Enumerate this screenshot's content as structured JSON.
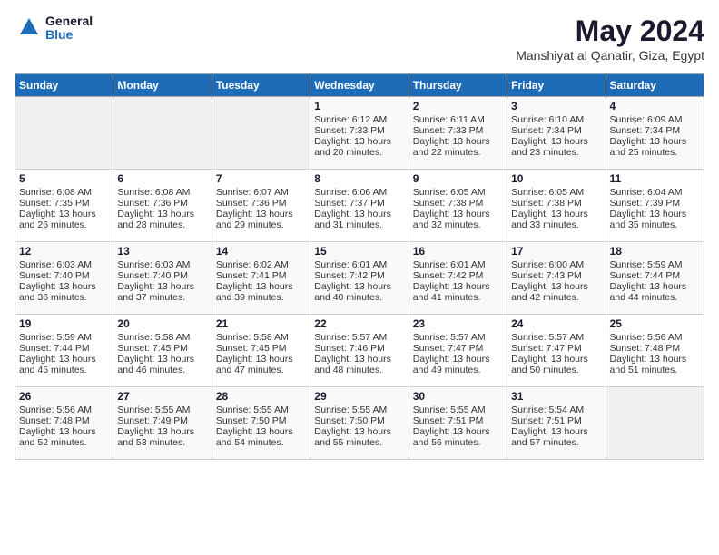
{
  "header": {
    "logo_general": "General",
    "logo_blue": "Blue",
    "month_year": "May 2024",
    "location": "Manshiyat al Qanatir, Giza, Egypt"
  },
  "calendar": {
    "days_of_week": [
      "Sunday",
      "Monday",
      "Tuesday",
      "Wednesday",
      "Thursday",
      "Friday",
      "Saturday"
    ],
    "weeks": [
      [
        {
          "day": "",
          "sunrise": "",
          "sunset": "",
          "daylight": ""
        },
        {
          "day": "",
          "sunrise": "",
          "sunset": "",
          "daylight": ""
        },
        {
          "day": "",
          "sunrise": "",
          "sunset": "",
          "daylight": ""
        },
        {
          "day": "1",
          "sunrise": "Sunrise: 6:12 AM",
          "sunset": "Sunset: 7:33 PM",
          "daylight": "Daylight: 13 hours and 20 minutes."
        },
        {
          "day": "2",
          "sunrise": "Sunrise: 6:11 AM",
          "sunset": "Sunset: 7:33 PM",
          "daylight": "Daylight: 13 hours and 22 minutes."
        },
        {
          "day": "3",
          "sunrise": "Sunrise: 6:10 AM",
          "sunset": "Sunset: 7:34 PM",
          "daylight": "Daylight: 13 hours and 23 minutes."
        },
        {
          "day": "4",
          "sunrise": "Sunrise: 6:09 AM",
          "sunset": "Sunset: 7:34 PM",
          "daylight": "Daylight: 13 hours and 25 minutes."
        }
      ],
      [
        {
          "day": "5",
          "sunrise": "Sunrise: 6:08 AM",
          "sunset": "Sunset: 7:35 PM",
          "daylight": "Daylight: 13 hours and 26 minutes."
        },
        {
          "day": "6",
          "sunrise": "Sunrise: 6:08 AM",
          "sunset": "Sunset: 7:36 PM",
          "daylight": "Daylight: 13 hours and 28 minutes."
        },
        {
          "day": "7",
          "sunrise": "Sunrise: 6:07 AM",
          "sunset": "Sunset: 7:36 PM",
          "daylight": "Daylight: 13 hours and 29 minutes."
        },
        {
          "day": "8",
          "sunrise": "Sunrise: 6:06 AM",
          "sunset": "Sunset: 7:37 PM",
          "daylight": "Daylight: 13 hours and 31 minutes."
        },
        {
          "day": "9",
          "sunrise": "Sunrise: 6:05 AM",
          "sunset": "Sunset: 7:38 PM",
          "daylight": "Daylight: 13 hours and 32 minutes."
        },
        {
          "day": "10",
          "sunrise": "Sunrise: 6:05 AM",
          "sunset": "Sunset: 7:38 PM",
          "daylight": "Daylight: 13 hours and 33 minutes."
        },
        {
          "day": "11",
          "sunrise": "Sunrise: 6:04 AM",
          "sunset": "Sunset: 7:39 PM",
          "daylight": "Daylight: 13 hours and 35 minutes."
        }
      ],
      [
        {
          "day": "12",
          "sunrise": "Sunrise: 6:03 AM",
          "sunset": "Sunset: 7:40 PM",
          "daylight": "Daylight: 13 hours and 36 minutes."
        },
        {
          "day": "13",
          "sunrise": "Sunrise: 6:03 AM",
          "sunset": "Sunset: 7:40 PM",
          "daylight": "Daylight: 13 hours and 37 minutes."
        },
        {
          "day": "14",
          "sunrise": "Sunrise: 6:02 AM",
          "sunset": "Sunset: 7:41 PM",
          "daylight": "Daylight: 13 hours and 39 minutes."
        },
        {
          "day": "15",
          "sunrise": "Sunrise: 6:01 AM",
          "sunset": "Sunset: 7:42 PM",
          "daylight": "Daylight: 13 hours and 40 minutes."
        },
        {
          "day": "16",
          "sunrise": "Sunrise: 6:01 AM",
          "sunset": "Sunset: 7:42 PM",
          "daylight": "Daylight: 13 hours and 41 minutes."
        },
        {
          "day": "17",
          "sunrise": "Sunrise: 6:00 AM",
          "sunset": "Sunset: 7:43 PM",
          "daylight": "Daylight: 13 hours and 42 minutes."
        },
        {
          "day": "18",
          "sunrise": "Sunrise: 5:59 AM",
          "sunset": "Sunset: 7:44 PM",
          "daylight": "Daylight: 13 hours and 44 minutes."
        }
      ],
      [
        {
          "day": "19",
          "sunrise": "Sunrise: 5:59 AM",
          "sunset": "Sunset: 7:44 PM",
          "daylight": "Daylight: 13 hours and 45 minutes."
        },
        {
          "day": "20",
          "sunrise": "Sunrise: 5:58 AM",
          "sunset": "Sunset: 7:45 PM",
          "daylight": "Daylight: 13 hours and 46 minutes."
        },
        {
          "day": "21",
          "sunrise": "Sunrise: 5:58 AM",
          "sunset": "Sunset: 7:45 PM",
          "daylight": "Daylight: 13 hours and 47 minutes."
        },
        {
          "day": "22",
          "sunrise": "Sunrise: 5:57 AM",
          "sunset": "Sunset: 7:46 PM",
          "daylight": "Daylight: 13 hours and 48 minutes."
        },
        {
          "day": "23",
          "sunrise": "Sunrise: 5:57 AM",
          "sunset": "Sunset: 7:47 PM",
          "daylight": "Daylight: 13 hours and 49 minutes."
        },
        {
          "day": "24",
          "sunrise": "Sunrise: 5:57 AM",
          "sunset": "Sunset: 7:47 PM",
          "daylight": "Daylight: 13 hours and 50 minutes."
        },
        {
          "day": "25",
          "sunrise": "Sunrise: 5:56 AM",
          "sunset": "Sunset: 7:48 PM",
          "daylight": "Daylight: 13 hours and 51 minutes."
        }
      ],
      [
        {
          "day": "26",
          "sunrise": "Sunrise: 5:56 AM",
          "sunset": "Sunset: 7:48 PM",
          "daylight": "Daylight: 13 hours and 52 minutes."
        },
        {
          "day": "27",
          "sunrise": "Sunrise: 5:55 AM",
          "sunset": "Sunset: 7:49 PM",
          "daylight": "Daylight: 13 hours and 53 minutes."
        },
        {
          "day": "28",
          "sunrise": "Sunrise: 5:55 AM",
          "sunset": "Sunset: 7:50 PM",
          "daylight": "Daylight: 13 hours and 54 minutes."
        },
        {
          "day": "29",
          "sunrise": "Sunrise: 5:55 AM",
          "sunset": "Sunset: 7:50 PM",
          "daylight": "Daylight: 13 hours and 55 minutes."
        },
        {
          "day": "30",
          "sunrise": "Sunrise: 5:55 AM",
          "sunset": "Sunset: 7:51 PM",
          "daylight": "Daylight: 13 hours and 56 minutes."
        },
        {
          "day": "31",
          "sunrise": "Sunrise: 5:54 AM",
          "sunset": "Sunset: 7:51 PM",
          "daylight": "Daylight: 13 hours and 57 minutes."
        },
        {
          "day": "",
          "sunrise": "",
          "sunset": "",
          "daylight": ""
        }
      ]
    ]
  }
}
